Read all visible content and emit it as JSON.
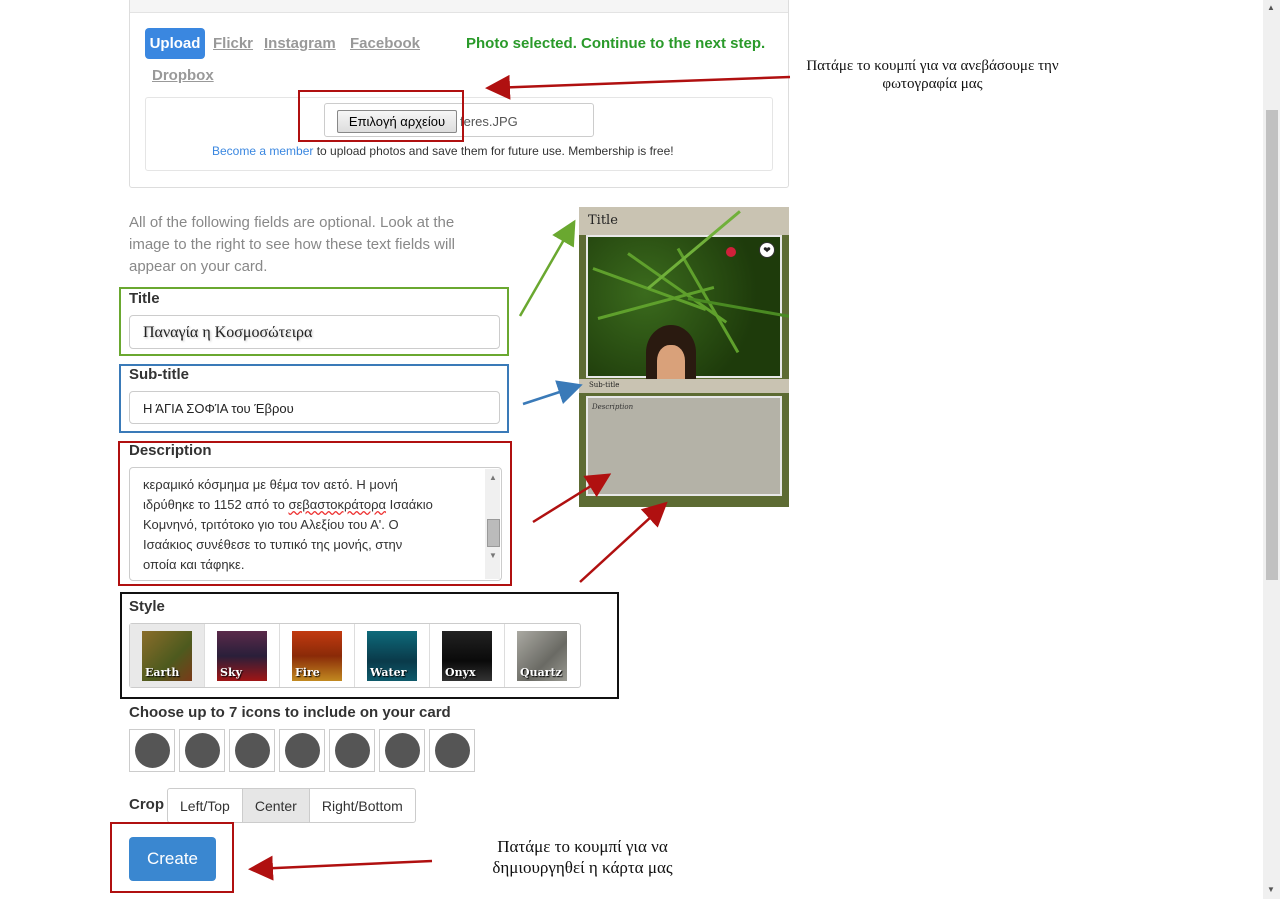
{
  "upload": {
    "tabs": [
      {
        "label": "Upload",
        "active": true
      },
      {
        "label": "Flickr"
      },
      {
        "label": "Instagram"
      },
      {
        "label": "Facebook"
      },
      {
        "label": "Dropbox"
      }
    ],
    "status_message": "Photo selected. Continue to the next step.",
    "file_button_label": "Επιλογή αρχείου",
    "file_name": "feres.JPG",
    "member_link": "Become a member",
    "member_text": " to upload photos and save them for future use. Membership is free!"
  },
  "form": {
    "intro": "All of the following fields are optional. Look at the image to the right to see how these text fields will appear on your card.",
    "title_label": "Title",
    "title_value": "Παναγία η Κοσμοσώτειρα",
    "subtitle_label": "Sub-title",
    "subtitle_value": "Η ΆΓΙΑ ΣΟΦΊΑ του Έβρου",
    "description_label": "Description",
    "description_lines": [
      "κεραμικό κόσμημα με θέμα τον αετό. Η μονή",
      "ιδρύθηκε το 1152 από το ",
      "σεβαστοκράτορα",
      " Ισαάκιο",
      "Κομνηνό, τριτότοκο γιο του Αλεξίου του Α'. Ο",
      "Ισαάκιος συνέθεσε το τυπικό της μονής, στην",
      "οποία και τάφηκε."
    ],
    "style_label": "Style",
    "styles": [
      {
        "name": "Earth",
        "selected": true,
        "color": "#6b5a2a"
      },
      {
        "name": "Sky",
        "color": "#3a1f3a"
      },
      {
        "name": "Fire",
        "color": "#b5360f"
      },
      {
        "name": "Water",
        "color": "#0e5a6b"
      },
      {
        "name": "Onyx",
        "color": "#111111"
      },
      {
        "name": "Quartz",
        "color": "#8a8a84"
      }
    ],
    "icons_label": "Choose up to 7 icons to include on your card",
    "crop_label": "Crop",
    "crop_options": [
      {
        "label": "Left/Top"
      },
      {
        "label": "Center",
        "selected": true
      },
      {
        "label": "Right/Bottom"
      }
    ],
    "create_label": "Create"
  },
  "card_preview": {
    "title": "Title",
    "subtitle": "Sub-title",
    "description": "Description"
  },
  "annotations": {
    "upload_note": "Πατάμε το κουμπί για να ανεβάσουμε την φωτογραφία μας",
    "create_note": "Πατάμε το κουμπί για να δημιουργηθεί η κάρτα μας"
  },
  "colors": {
    "primary": "#3a87e0",
    "success": "#2a9a2a",
    "annotation_red": "#b01010",
    "annotation_green": "#6aa830",
    "annotation_blue": "#3a7ab8"
  }
}
